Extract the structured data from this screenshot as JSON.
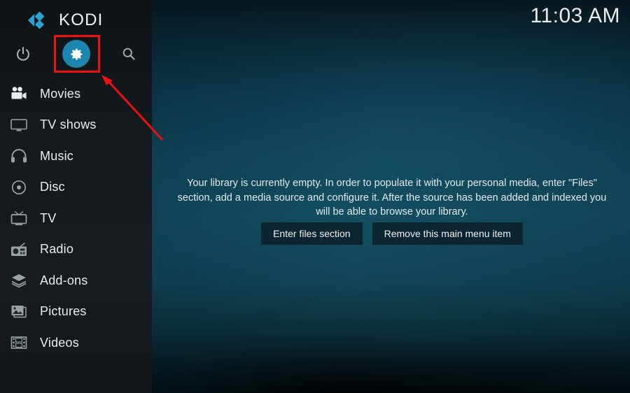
{
  "app": {
    "name": "KODI",
    "logo_icon": "kodi-logo-icon"
  },
  "clock": {
    "time": "11:03 AM"
  },
  "top_bar": {
    "power_icon": "power-icon",
    "settings_icon": "gear-icon",
    "search_icon": "search-icon"
  },
  "sidebar": {
    "items": [
      {
        "label": "Movies",
        "icon": "movie-camera-icon"
      },
      {
        "label": "TV shows",
        "icon": "tv-monitor-icon"
      },
      {
        "label": "Music",
        "icon": "headphones-icon"
      },
      {
        "label": "Disc",
        "icon": "disc-icon"
      },
      {
        "label": "TV",
        "icon": "retro-tv-icon"
      },
      {
        "label": "Radio",
        "icon": "radio-icon"
      },
      {
        "label": "Add-ons",
        "icon": "addons-box-icon"
      },
      {
        "label": "Pictures",
        "icon": "pictures-icon"
      },
      {
        "label": "Videos",
        "icon": "film-strip-icon"
      }
    ]
  },
  "main": {
    "empty_message": "Your library is currently empty. In order to populate it with your personal media, enter \"Files\" section, add a media source and configure it. After the source has been added and indexed you will be able to browse your library.",
    "buttons": {
      "enter_files": "Enter files section",
      "remove_item": "Remove this main menu item"
    }
  },
  "annotation": {
    "highlight_color": "#ee1111",
    "arrow_icon": "arrow-pointer-icon",
    "target": "settings-button"
  },
  "colors": {
    "accent": "#1b86ae",
    "sidebar_bg": "#141a1d",
    "main_bg": "#114254",
    "text": "#e9edee"
  }
}
